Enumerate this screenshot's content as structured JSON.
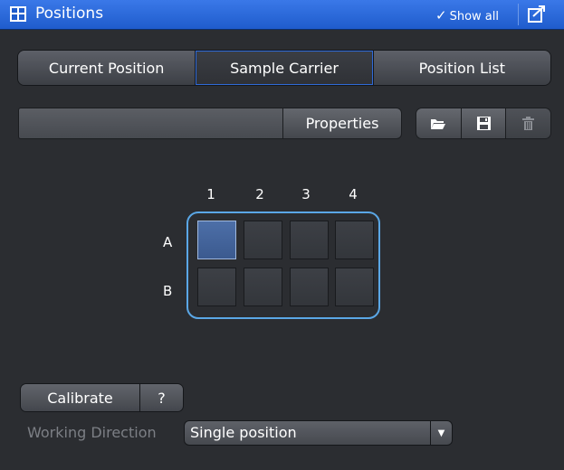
{
  "window": {
    "title": "Positions",
    "show_all": "Show all"
  },
  "tabs": [
    {
      "label": "Current Position",
      "active": false
    },
    {
      "label": "Sample Carrier",
      "active": true
    },
    {
      "label": "Position List",
      "active": false
    }
  ],
  "toolbar": {
    "name_value": "",
    "properties_label": "Properties",
    "icons": [
      "open-folder-icon",
      "save-icon",
      "delete-icon"
    ]
  },
  "carrier": {
    "columns": [
      "1",
      "2",
      "3",
      "4"
    ],
    "rows": [
      "A",
      "B"
    ],
    "selected_well": "A1"
  },
  "calibrate": {
    "label": "Calibrate",
    "help": "?"
  },
  "working_direction": {
    "label": "Working Direction",
    "value": "Single position"
  },
  "colors": {
    "title_bar": "#2a6ad8",
    "carrier_outline": "#5aa7e6",
    "selected_well": "#4d6fa8"
  }
}
